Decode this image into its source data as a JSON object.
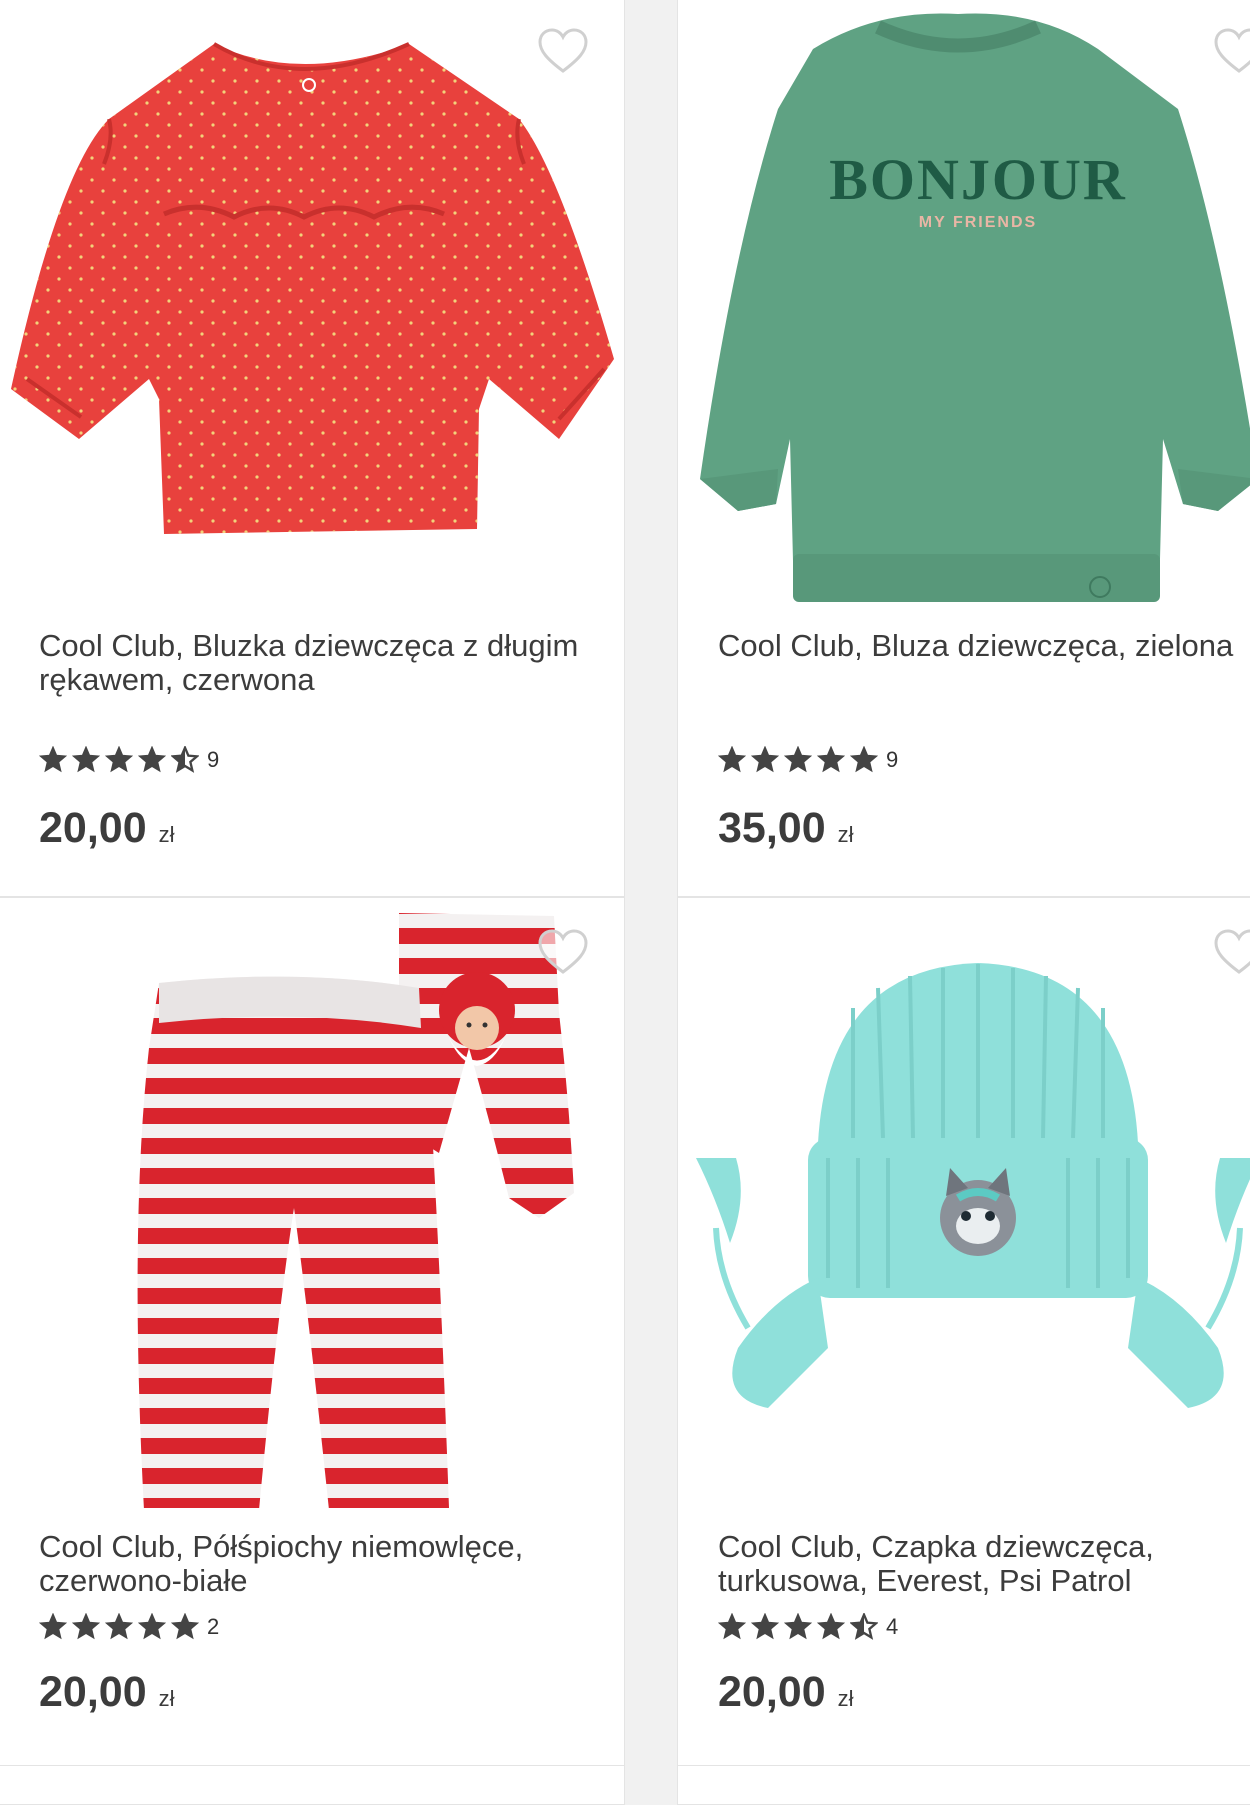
{
  "products": [
    {
      "title": "Cool Club, Bluzka dziewczęca z długim rękawem, czerwona",
      "rating": 4.5,
      "review_count": "9",
      "price": "20,00",
      "currency": "zł",
      "image": "red-polka-dot-blouse",
      "color": "#e8413d"
    },
    {
      "title": "Cool Club, Bluza dziewczęca, zielona",
      "rating": 5,
      "review_count": "9",
      "price": "35,00",
      "currency": "zł",
      "image": "green-sweatshirt",
      "color": "#5fa283",
      "print_main": "BONJOUR",
      "print_sub": "MY FRIENDS"
    },
    {
      "title": "Cool Club, Półśpiochy niemowlęce, czerwono-białe",
      "rating": 5,
      "review_count": "2",
      "price": "20,00",
      "currency": "zł",
      "image": "striped-baby-pants",
      "color": "#d9242d"
    },
    {
      "title": "Cool Club, Czapka dziewczęca, turkusowa, Everest, Psi Patrol",
      "rating": 4.5,
      "review_count": "4",
      "price": "20,00",
      "currency": "zł",
      "image": "turquoise-hat",
      "color": "#8fe0da"
    }
  ],
  "icons": {
    "favorite": "heart-outline-icon",
    "star": "star-icon",
    "half_star": "star-half-icon"
  }
}
